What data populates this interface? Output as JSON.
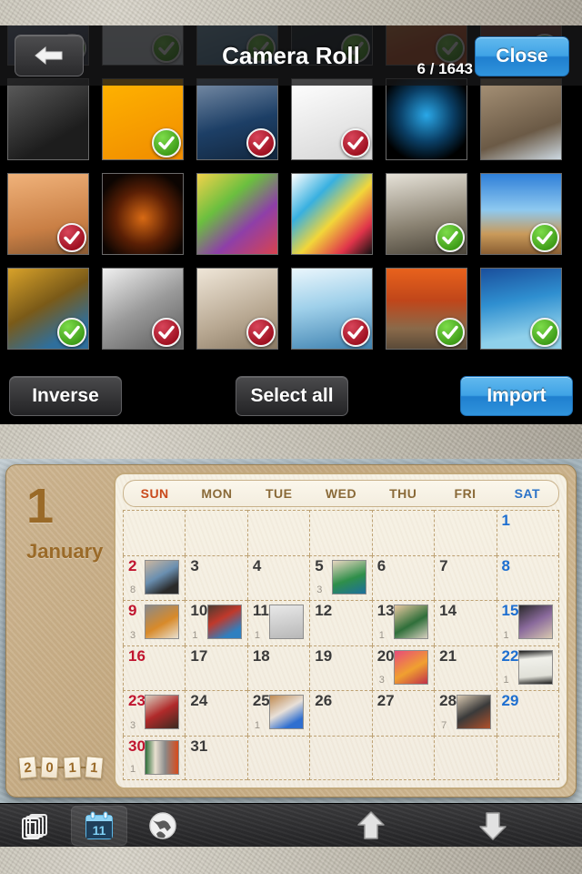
{
  "picker": {
    "title": "Camera Roll",
    "counter": "6 / 1643",
    "close_label": "Close",
    "back_icon": "back-arrow-icon",
    "footer": {
      "inverse_label": "Inverse",
      "select_all_label": "Select all",
      "import_label": "Import"
    },
    "accent_blue": "#3fa3e6",
    "badge_green": "#3d9b17",
    "badge_red": "#9d0f1f",
    "thumbnails": [
      {
        "art": "linear-gradient(160deg,#8fa6c0,#55607a 60%,#2d3340)",
        "badge": "green"
      },
      {
        "art": "linear-gradient(180deg,#eef1f4,#cdd6de)",
        "badge": "green"
      },
      {
        "art": "linear-gradient(160deg,#9fc3d8,#3f6f92)",
        "badge": "green"
      },
      {
        "art": "linear-gradient(160deg,#1b2a33,#0a1218)",
        "badge": "green"
      },
      {
        "art": "linear-gradient(160deg,#e8b05a,#c94f22 70%)",
        "badge": "green"
      },
      {
        "art": "linear-gradient(160deg,#9c5148,#6a332c)",
        "badge": "green"
      },
      {
        "art": "linear-gradient(150deg,#5d5d5d,#1d1d1d 70%)",
        "badge": "none"
      },
      {
        "art": "linear-gradient(160deg,#ffb300,#f08c00)",
        "badge": "green"
      },
      {
        "art": "linear-gradient(165deg,#7b8fa8,#1d3f66 55%,#12263d)",
        "badge": "red"
      },
      {
        "art": "linear-gradient(160deg,#ffffff,#d5d5d5)",
        "badge": "red"
      },
      {
        "art": "radial-gradient(circle at 50% 45%, #2aa8e8 0%, #0a3f66 45%, #000 80%)",
        "badge": "none"
      },
      {
        "art": "linear-gradient(160deg,#a89378,#6b5a46 65%,#cdd9e2)",
        "badge": "none"
      },
      {
        "art": "linear-gradient(170deg,#f0b27a,#c97f45 65%,#8a5a33)",
        "badge": "red"
      },
      {
        "art": "radial-gradient(circle at 50% 55%, #d86a14 0%, #5a1f05 45%, #0c0502 80%)",
        "badge": "none"
      },
      {
        "art": "linear-gradient(140deg,#f2d24a,#6bbf3f 35%,#8e3fa8 65%,#d8434f)",
        "badge": "none"
      },
      {
        "art": "linear-gradient(135deg,#ffffff,#38b0e0 30%,#f2d63a 55%,#e0344a 80%,#111)",
        "badge": "none"
      },
      {
        "art": "linear-gradient(170deg,#e6e2d8,#8a8272 60%,#4a4439)",
        "badge": "green"
      },
      {
        "art": "linear-gradient(180deg,#2f7fd8,#8ec9f0 45%,#c99a5a 75%,#8a5f33)",
        "badge": "green"
      },
      {
        "art": "linear-gradient(150deg,#d8a22a,#7a5a18 45%,#2f6f9c 80%)",
        "badge": "green"
      },
      {
        "art": "linear-gradient(150deg,#f0f0f0,#9a9a9a 50%,#5a5a5a)",
        "badge": "red"
      },
      {
        "art": "linear-gradient(160deg,#efe6d8,#b8a892 60%,#8a7a64)",
        "badge": "red"
      },
      {
        "art": "linear-gradient(170deg,#eaf6fc,#9fd0ea 45%,#3f82b0)",
        "badge": "red"
      },
      {
        "art": "linear-gradient(180deg,#e8621c,#c0461a 40%,#8a6a4a 75%,#5a4a38)",
        "badge": "green"
      },
      {
        "art": "linear-gradient(170deg,#1a4f9c,#2f8fd0 40%,#8fd0ea 80%)",
        "badge": "green"
      }
    ]
  },
  "calendar": {
    "month_number": "1",
    "month_name": "January",
    "year_digits": [
      "2",
      "0",
      "1",
      "1"
    ],
    "dow": [
      "SUN",
      "MON",
      "TUE",
      "WED",
      "THU",
      "FRI",
      "SAT"
    ],
    "weeks": [
      [
        {
          "day": "",
          "count": "",
          "thumb": ""
        },
        {
          "day": "",
          "count": "",
          "thumb": ""
        },
        {
          "day": "",
          "count": "",
          "thumb": ""
        },
        {
          "day": "",
          "count": "",
          "thumb": ""
        },
        {
          "day": "",
          "count": "",
          "thumb": ""
        },
        {
          "day": "",
          "count": "",
          "thumb": ""
        },
        {
          "day": "1",
          "count": "",
          "thumb": ""
        }
      ],
      [
        {
          "day": "2",
          "count": "8",
          "thumb": "linear-gradient(150deg,#cbb6a0,#6a8fb0 45%,#2a2a2a 80%)"
        },
        {
          "day": "3",
          "count": "",
          "thumb": ""
        },
        {
          "day": "4",
          "count": "",
          "thumb": ""
        },
        {
          "day": "5",
          "count": "3",
          "thumb": "linear-gradient(160deg,#e8d6c0,#2f8f4a 55%,#1d6f9c)"
        },
        {
          "day": "6",
          "count": "",
          "thumb": ""
        },
        {
          "day": "7",
          "count": "",
          "thumb": ""
        },
        {
          "day": "8",
          "count": "",
          "thumb": ""
        }
      ],
      [
        {
          "day": "9",
          "count": "3",
          "thumb": "linear-gradient(150deg,#8a8a8a,#d88a2a 55%,#e8e0d0)"
        },
        {
          "day": "10",
          "count": "1",
          "thumb": "linear-gradient(150deg,#4a3a30,#c0392b 40%,#2f7fc0 80%)"
        },
        {
          "day": "11",
          "count": "1",
          "thumb": "linear-gradient(170deg,#e8e8e8,#b8b8b8)"
        },
        {
          "day": "12",
          "count": "",
          "thumb": ""
        },
        {
          "day": "13",
          "count": "1",
          "thumb": "linear-gradient(150deg,#e8c8a0,#2f6f3a 55%,#d8d0c0)"
        },
        {
          "day": "14",
          "count": "",
          "thumb": ""
        },
        {
          "day": "15",
          "count": "1",
          "thumb": "linear-gradient(150deg,#2a2a2a,#8a6a9c 50%,#d8c8b0)"
        }
      ],
      [
        {
          "day": "16",
          "count": "",
          "thumb": ""
        },
        {
          "day": "17",
          "count": "",
          "thumb": ""
        },
        {
          "day": "18",
          "count": "",
          "thumb": ""
        },
        {
          "day": "19",
          "count": "",
          "thumb": ""
        },
        {
          "day": "20",
          "count": "3",
          "thumb": "linear-gradient(150deg,#e84a7a,#f0a030 55%,#c0304a)"
        },
        {
          "day": "21",
          "count": "",
          "thumb": ""
        },
        {
          "day": "22",
          "count": "1",
          "thumb": "linear-gradient(175deg,#1a1a1a,#f0f0ea 25%,#e0e0d8 75%,#1a1a1a)"
        }
      ],
      [
        {
          "day": "23",
          "count": "3",
          "thumb": "linear-gradient(150deg,#d8d0c0,#b02a2a 50%,#3a2a20)"
        },
        {
          "day": "24",
          "count": "",
          "thumb": ""
        },
        {
          "day": "25",
          "count": "1",
          "thumb": "linear-gradient(150deg,#c08a50,#e8e0d8 45%,#2f6fd0 80%)"
        },
        {
          "day": "26",
          "count": "",
          "thumb": ""
        },
        {
          "day": "27",
          "count": "",
          "thumb": ""
        },
        {
          "day": "28",
          "count": "7",
          "thumb": "linear-gradient(150deg,#d8c8b0,#3a3a3a 50%,#b0502a)"
        },
        {
          "day": "29",
          "count": "",
          "thumb": ""
        }
      ],
      [
        {
          "day": "30",
          "count": "1",
          "thumb": "linear-gradient(90deg,#2f6f3a,#e8e0d0 30%,#8a8a8a 60%,#d84a1a)"
        },
        {
          "day": "31",
          "count": "",
          "thumb": ""
        },
        {
          "day": "",
          "count": "",
          "thumb": ""
        },
        {
          "day": "",
          "count": "",
          "thumb": ""
        },
        {
          "day": "",
          "count": "",
          "thumb": ""
        },
        {
          "day": "",
          "count": "",
          "thumb": ""
        },
        {
          "day": "",
          "count": "",
          "thumb": ""
        }
      ]
    ]
  },
  "tabbar": {
    "albums_icon": "albums-stack-icon",
    "calendar_icon": "calendar-icon",
    "calendar_icon_day": "11",
    "globe_icon": "globe-icon",
    "upload_icon": "up-arrow-icon",
    "download_icon": "down-arrow-icon"
  }
}
